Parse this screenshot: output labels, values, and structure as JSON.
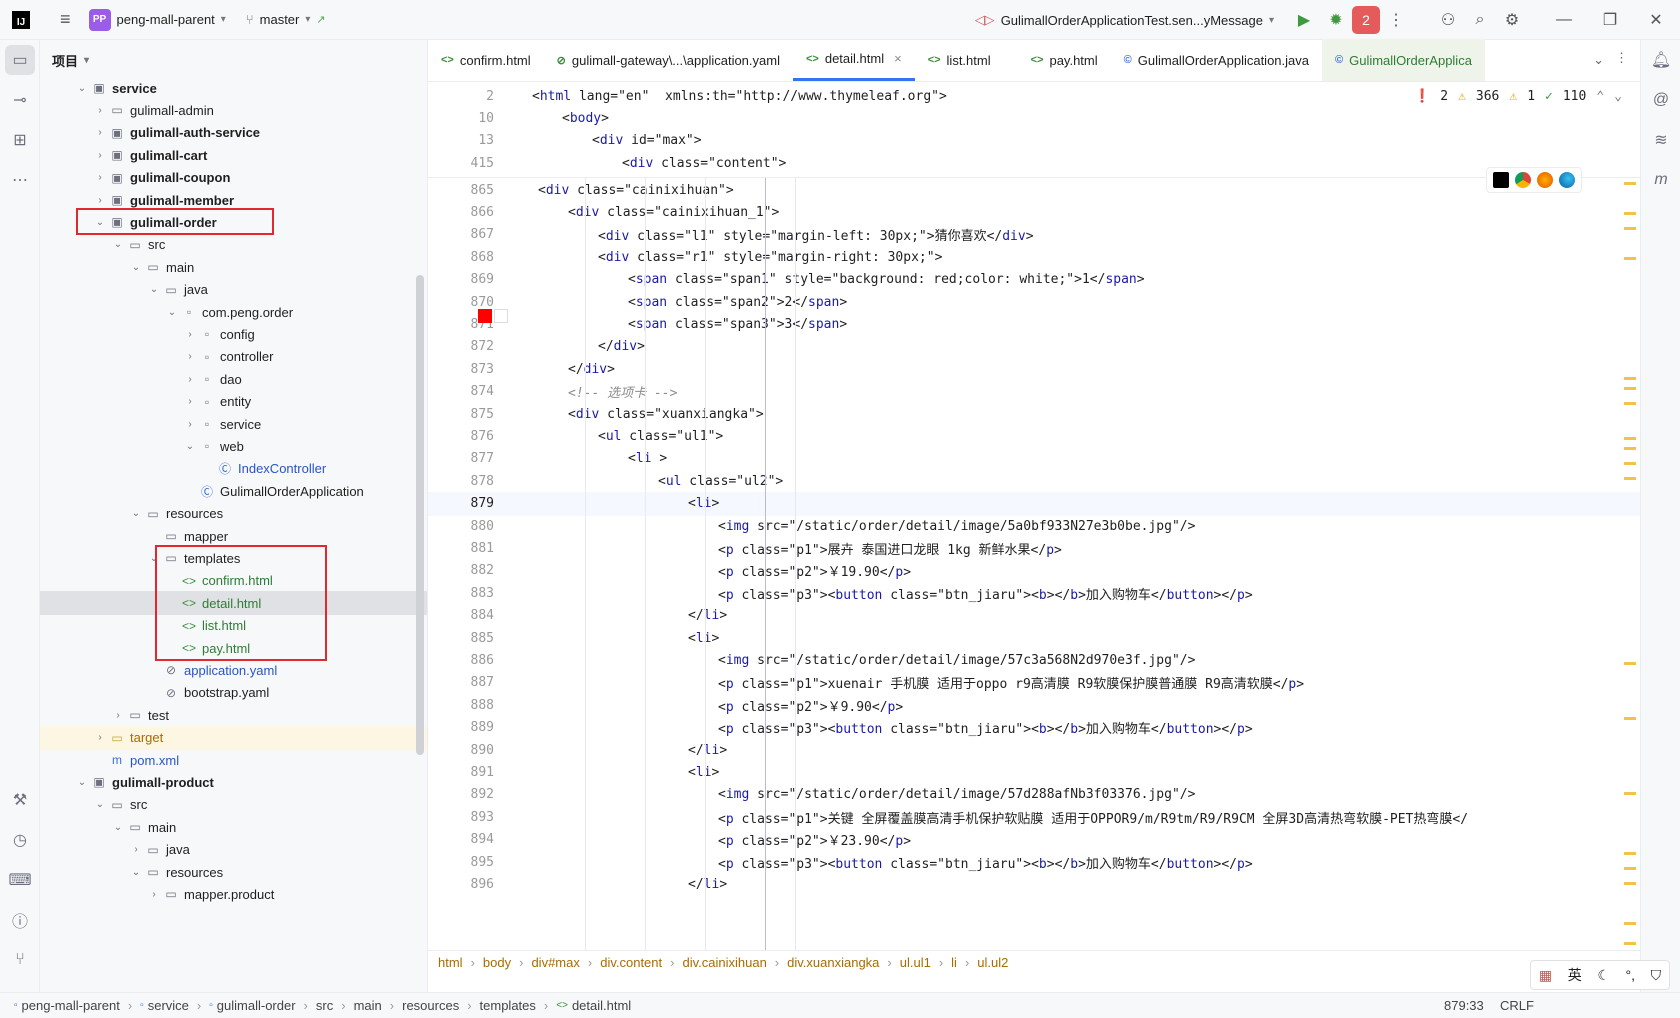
{
  "titlebar": {
    "logo": "IJ",
    "project_badge": "PP",
    "project_name": "peng-mall-parent",
    "branch": "master",
    "run_config": "GulimallOrderApplicationTest.sen...yMessage",
    "stop_count": "2"
  },
  "project_panel": {
    "title": "项目",
    "items": [
      {
        "label": "service",
        "bold": true
      },
      {
        "label": "gulimall-admin"
      },
      {
        "label": "gulimall-auth-service",
        "bold": true
      },
      {
        "label": "gulimall-cart",
        "bold": true
      },
      {
        "label": "gulimall-coupon",
        "bold": true
      },
      {
        "label": "gulimall-member",
        "bold": true
      },
      {
        "label": "gulimall-order",
        "bold": true
      },
      {
        "label": "src"
      },
      {
        "label": "main"
      },
      {
        "label": "java"
      },
      {
        "label": "com.peng.order"
      },
      {
        "label": "config"
      },
      {
        "label": "controller"
      },
      {
        "label": "dao"
      },
      {
        "label": "entity"
      },
      {
        "label": "service"
      },
      {
        "label": "web"
      },
      {
        "label": "IndexController"
      },
      {
        "label": "GulimallOrderApplication"
      },
      {
        "label": "resources"
      },
      {
        "label": "mapper"
      },
      {
        "label": "templates"
      },
      {
        "label": "confirm.html"
      },
      {
        "label": "detail.html"
      },
      {
        "label": "list.html"
      },
      {
        "label": "pay.html"
      },
      {
        "label": "application.yaml"
      },
      {
        "label": "bootstrap.yaml"
      },
      {
        "label": "test"
      },
      {
        "label": "target"
      },
      {
        "label": "pom.xml"
      },
      {
        "label": "gulimall-product",
        "bold": true
      },
      {
        "label": "src"
      },
      {
        "label": "main"
      },
      {
        "label": "java"
      },
      {
        "label": "resources"
      },
      {
        "label": "mapper.product"
      }
    ]
  },
  "tabs": [
    {
      "label": "confirm.html"
    },
    {
      "label": "gulimall-gateway\\...\\application.yaml"
    },
    {
      "label": "detail.html"
    },
    {
      "label": "list.html"
    },
    {
      "label": "pay.html"
    },
    {
      "label": "GulimallOrderApplication.java"
    },
    {
      "label": "GulimallOrderApplica"
    }
  ],
  "inspections": {
    "errors": "2",
    "warnings": "366",
    "weak": "1",
    "ok": "110"
  },
  "sticky_lines": [
    {
      "num": "2",
      "text": "<html lang=\"en\"  xmlns:th=\"http://www.thymeleaf.org\">"
    },
    {
      "num": "10",
      "text": "<body>"
    },
    {
      "num": "13",
      "text": "<div id=\"max\">"
    },
    {
      "num": "415",
      "text": "<div class=\"content\">"
    }
  ],
  "code_lines": [
    {
      "num": "865",
      "text": "<div class=\"cainixihuan\">"
    },
    {
      "num": "866",
      "text": "<div class=\"cainixihuan_1\">"
    },
    {
      "num": "867",
      "text": "<div class=\"l1\" style=\"margin-left: 30px;\">猜你喜欢</div>"
    },
    {
      "num": "868",
      "text": "<div class=\"r1\" style=\"margin-right: 30px;\">"
    },
    {
      "num": "869",
      "text": "<span class=\"span1\" style=\"background: red;color: white;\">1</span>"
    },
    {
      "num": "870",
      "text": "<span class=\"span2\">2</span>"
    },
    {
      "num": "871",
      "text": "<span class=\"span3\">3</span>"
    },
    {
      "num": "872",
      "text": "</div>"
    },
    {
      "num": "873",
      "text": "</div>"
    },
    {
      "num": "874",
      "text": "<!-- 选项卡 -->"
    },
    {
      "num": "875",
      "text": "<div class=\"xuanxiangka\">"
    },
    {
      "num": "876",
      "text": "<ul class=\"ul1\">"
    },
    {
      "num": "877",
      "text": "<li >"
    },
    {
      "num": "878",
      "text": "<ul class=\"ul2\">"
    },
    {
      "num": "879",
      "text": "<li>"
    },
    {
      "num": "880",
      "text": "<img src=\"/static/order/detail/image/5a0bf933N27e3b0be.jpg\"/>"
    },
    {
      "num": "881",
      "text": "<p class=\"p1\">展卉 泰国进口龙眼 1kg 新鲜水果</p>"
    },
    {
      "num": "882",
      "text": "<p class=\"p2\">￥19.90</p>"
    },
    {
      "num": "883",
      "text": "<p class=\"p3\"><button class=\"btn_jiaru\"><b></b>加入购物车</button></p>"
    },
    {
      "num": "884",
      "text": "</li>"
    },
    {
      "num": "885",
      "text": "<li>"
    },
    {
      "num": "886",
      "text": "<img src=\"/static/order/detail/image/57c3a568N2d970e3f.jpg\"/>"
    },
    {
      "num": "887",
      "text": "<p class=\"p1\">xuenair 手机膜 适用于oppo r9高清膜 R9软膜保护膜普通膜 R9高清软膜</p>"
    },
    {
      "num": "888",
      "text": "<p class=\"p2\">￥9.90</p>"
    },
    {
      "num": "889",
      "text": "<p class=\"p3\"><button class=\"btn_jiaru\"><b></b>加入购物车</button></p>"
    },
    {
      "num": "890",
      "text": "</li>"
    },
    {
      "num": "891",
      "text": "<li>"
    },
    {
      "num": "892",
      "text": "<img src=\"/static/order/detail/image/57d288afNb3f03376.jpg\"/>"
    },
    {
      "num": "893",
      "text": "<p class=\"p1\">关键 全屏覆盖膜高清手机保护软贴膜 适用于OPPOR9/m/R9tm/R9/R9CM 全屏3D高清热弯软膜-PET热弯膜</"
    },
    {
      "num": "894",
      "text": "<p class=\"p2\">￥23.90</p>"
    },
    {
      "num": "895",
      "text": "<p class=\"p3\"><button class=\"btn_jiaru\"><b></b>加入购物车</button></p>"
    },
    {
      "num": "896",
      "text": "</li>"
    }
  ],
  "breadcrumb": [
    "html",
    "body",
    "div#max",
    "div.content",
    "div.cainixihuan",
    "div.xuanxiangka",
    "ul.ul1",
    "li",
    "ul.ul2"
  ],
  "statusbar": {
    "path": [
      "peng-mall-parent",
      "service",
      "gulimall-order",
      "src",
      "main",
      "resources",
      "templates",
      "detail.html"
    ],
    "position": "879:33",
    "line_sep": "CRLF"
  },
  "ime": {
    "lang": "英"
  },
  "colors": {
    "accent": "#3574f0",
    "highlight_box": "#e0282e",
    "error": "#e55b5b"
  }
}
